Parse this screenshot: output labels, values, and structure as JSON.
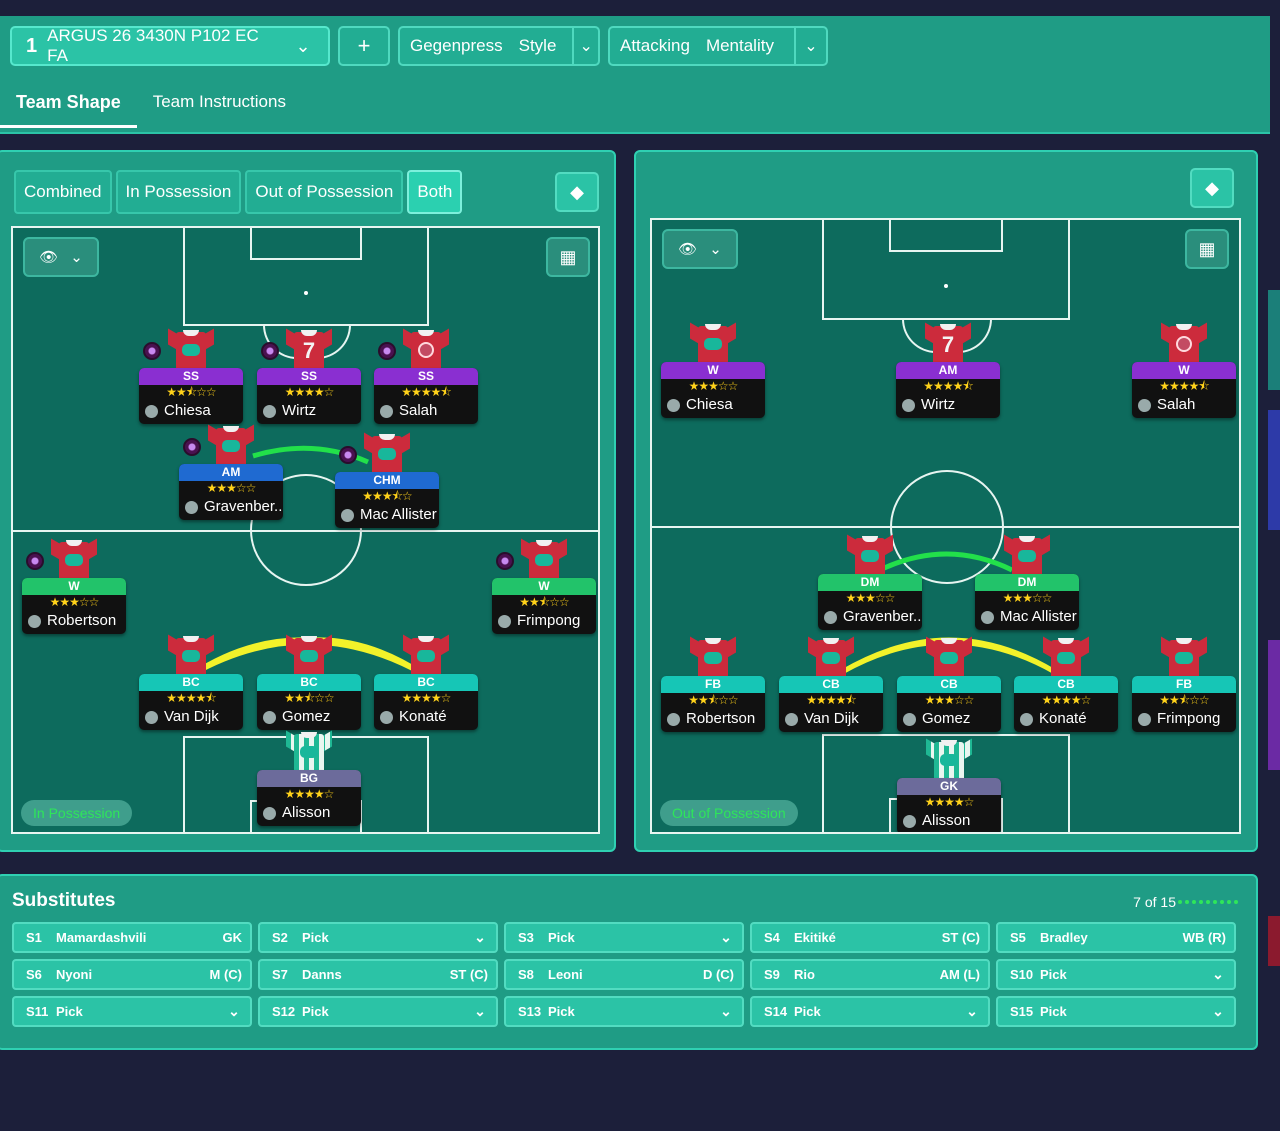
{
  "breadcrumb": "",
  "toolbar": {
    "tactic_number": "1",
    "tactic_name": "ARGUS 26 3430N P102 EC FA",
    "add_label": "+",
    "style": {
      "a": "Gegenpress",
      "b": "Style"
    },
    "mentality": {
      "a": "Attacking",
      "b": "Mentality"
    }
  },
  "tabs": [
    {
      "label": "Team Shape",
      "active": true
    },
    {
      "label": "Team Instructions",
      "active": false
    }
  ],
  "view_tabs": [
    {
      "label": "Combined",
      "active": false
    },
    {
      "label": "In Possession",
      "active": false
    },
    {
      "label": "Out of Possession",
      "active": false
    },
    {
      "label": "Both",
      "active": true
    }
  ],
  "phase_labels": {
    "left": "In Possession",
    "right": "Out of Possession"
  },
  "colors": {
    "panel": "#1f9c85",
    "pitch": "#0d6b5d",
    "accent": "#2bc3a6",
    "star": "#ffd21a",
    "green_ok": "#2ee65a"
  },
  "in_possession": [
    {
      "id": "chiesa",
      "role": "SS",
      "color": "purple",
      "stars": "★★⯪☆☆",
      "name": "Chiesa",
      "shirt_number": "",
      "crest": "normal",
      "armband": true
    },
    {
      "id": "wirtz",
      "role": "SS",
      "color": "purple",
      "stars": "★★★★☆",
      "name": "Wirtz",
      "shirt_number": "7",
      "crest": "none",
      "armband": true
    },
    {
      "id": "salah",
      "role": "SS",
      "color": "purple",
      "stars": "★★★★⯪",
      "name": "Salah",
      "shirt_number": "",
      "crest": "alt",
      "armband": true
    },
    {
      "id": "gravenberch",
      "role": "AM",
      "color": "blue",
      "stars": "★★★☆☆",
      "name": "Gravenber...",
      "shirt_number": "",
      "crest": "normal",
      "armband": true
    },
    {
      "id": "macallister",
      "role": "CHM",
      "color": "blue",
      "stars": "★★★⯪☆",
      "name": "Mac Allister",
      "shirt_number": "",
      "crest": "normal",
      "armband": true
    },
    {
      "id": "robertson",
      "role": "W",
      "color": "green",
      "stars": "★★★☆☆",
      "name": "Robertson",
      "shirt_number": "",
      "crest": "normal",
      "armband": true
    },
    {
      "id": "frimpong",
      "role": "W",
      "color": "green",
      "stars": "★★⯪☆☆",
      "name": "Frimpong",
      "shirt_number": "",
      "crest": "normal",
      "armband": true
    },
    {
      "id": "vandijk",
      "role": "BC",
      "color": "teal",
      "stars": "★★★★⯪",
      "name": "Van Dijk",
      "shirt_number": "",
      "crest": "normal",
      "armband": false
    },
    {
      "id": "gomez",
      "role": "BC",
      "color": "teal",
      "stars": "★★⯪☆☆",
      "name": "Gomez",
      "shirt_number": "",
      "crest": "normal",
      "armband": false
    },
    {
      "id": "konate",
      "role": "BC",
      "color": "teal",
      "stars": "★★★★☆",
      "name": "Konaté",
      "shirt_number": "",
      "crest": "normal",
      "armband": false
    },
    {
      "id": "alisson",
      "role": "BG",
      "color": "grey",
      "stars": "★★★★☆",
      "name": "Alisson",
      "shirt_number": "",
      "crest": "normal",
      "armband": false,
      "gk": true
    }
  ],
  "out_of_possession": [
    {
      "id": "chiesa",
      "role": "W",
      "color": "purple",
      "stars": "★★★☆☆",
      "name": "Chiesa",
      "shirt_number": "",
      "crest": "normal"
    },
    {
      "id": "wirtz",
      "role": "AM",
      "color": "purple",
      "stars": "★★★★⯪",
      "name": "Wirtz",
      "shirt_number": "7",
      "crest": "none"
    },
    {
      "id": "salah",
      "role": "W",
      "color": "purple",
      "stars": "★★★★⯪",
      "name": "Salah",
      "shirt_number": "",
      "crest": "alt"
    },
    {
      "id": "gravenberch",
      "role": "DM",
      "color": "green",
      "stars": "★★★☆☆",
      "name": "Gravenber...",
      "shirt_number": "",
      "crest": "normal"
    },
    {
      "id": "macallister",
      "role": "DM",
      "color": "green",
      "stars": "★★★☆☆",
      "name": "Mac Allister",
      "shirt_number": "",
      "crest": "normal"
    },
    {
      "id": "robertson",
      "role": "FB",
      "color": "teal",
      "stars": "★★⯪☆☆",
      "name": "Robertson",
      "shirt_number": "",
      "crest": "normal"
    },
    {
      "id": "vandijk",
      "role": "CB",
      "color": "teal",
      "stars": "★★★★⯪",
      "name": "Van Dijk",
      "shirt_number": "",
      "crest": "normal"
    },
    {
      "id": "gomez",
      "role": "CB",
      "color": "teal",
      "stars": "★★★☆☆",
      "name": "Gomez",
      "shirt_number": "",
      "crest": "normal"
    },
    {
      "id": "konate",
      "role": "CB",
      "color": "teal",
      "stars": "★★★★☆",
      "name": "Konaté",
      "shirt_number": "",
      "crest": "normal"
    },
    {
      "id": "frimpong",
      "role": "FB",
      "color": "teal",
      "stars": "★★⯪☆☆",
      "name": "Frimpong",
      "shirt_number": "",
      "crest": "normal"
    },
    {
      "id": "alisson",
      "role": "GK",
      "color": "grey",
      "stars": "★★★★☆",
      "name": "Alisson",
      "shirt_number": "",
      "crest": "normal",
      "gk": true
    }
  ],
  "substitutes": {
    "title": "Substitutes",
    "count": "7 of 15",
    "slots": [
      {
        "slot": "S1",
        "name": "Mamardashvili",
        "pos": "GK",
        "pick": false
      },
      {
        "slot": "S2",
        "name": "Pick",
        "pos": "",
        "pick": true
      },
      {
        "slot": "S3",
        "name": "Pick",
        "pos": "",
        "pick": true
      },
      {
        "slot": "S4",
        "name": "Ekitiké",
        "pos": "ST (C)",
        "pick": false
      },
      {
        "slot": "S5",
        "name": "Bradley",
        "pos": "WB (R)",
        "pick": false
      },
      {
        "slot": "S6",
        "name": "Nyoni",
        "pos": "M (C)",
        "pick": false
      },
      {
        "slot": "S7",
        "name": "Danns",
        "pos": "ST (C)",
        "pick": false
      },
      {
        "slot": "S8",
        "name": "Leoni",
        "pos": "D (C)",
        "pick": false
      },
      {
        "slot": "S9",
        "name": "Rio",
        "pos": "AM (L)",
        "pick": false
      },
      {
        "slot": "S10",
        "name": "Pick",
        "pos": "",
        "pick": true
      },
      {
        "slot": "S11",
        "name": "Pick",
        "pos": "",
        "pick": true
      },
      {
        "slot": "S12",
        "name": "Pick",
        "pos": "",
        "pick": true
      },
      {
        "slot": "S13",
        "name": "Pick",
        "pos": "",
        "pick": true
      },
      {
        "slot": "S14",
        "name": "Pick",
        "pos": "",
        "pick": true
      },
      {
        "slot": "S15",
        "name": "Pick",
        "pos": "",
        "pick": true
      }
    ]
  }
}
